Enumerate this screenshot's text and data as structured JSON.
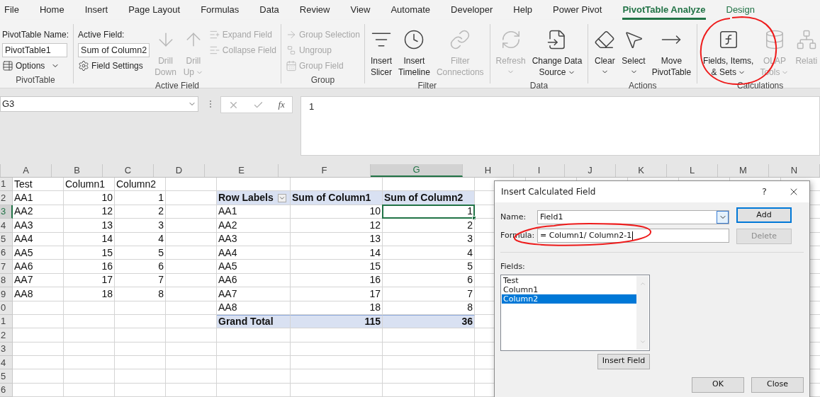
{
  "ribbon": {
    "tabs": [
      {
        "label": "File",
        "selected": false,
        "contextual": false
      },
      {
        "label": "Home",
        "selected": false,
        "contextual": false
      },
      {
        "label": "Insert",
        "selected": false,
        "contextual": false
      },
      {
        "label": "Page Layout",
        "selected": false,
        "contextual": false
      },
      {
        "label": "Formulas",
        "selected": false,
        "contextual": false
      },
      {
        "label": "Data",
        "selected": false,
        "contextual": false
      },
      {
        "label": "Review",
        "selected": false,
        "contextual": false
      },
      {
        "label": "View",
        "selected": false,
        "contextual": false
      },
      {
        "label": "Automate",
        "selected": false,
        "contextual": false
      },
      {
        "label": "Developer",
        "selected": false,
        "contextual": false
      },
      {
        "label": "Help",
        "selected": false,
        "contextual": false
      },
      {
        "label": "Power Pivot",
        "selected": false,
        "contextual": false
      },
      {
        "label": "PivotTable Analyze",
        "selected": true,
        "contextual": true
      },
      {
        "label": "Design",
        "selected": false,
        "contextual": true
      }
    ],
    "groups": [
      {
        "label": "PivotTable",
        "columns": [
          [
            {
              "kind": "label",
              "label": "PivotTable Name:"
            },
            {
              "kind": "field",
              "value": "PivotTable1"
            },
            {
              "kind": "small",
              "label": "Options",
              "disabled": false,
              "dropdown": true
            }
          ]
        ]
      },
      {
        "label": "Active Field",
        "columns": [
          [
            {
              "kind": "label",
              "label": "Active Field:"
            },
            {
              "kind": "field",
              "value": "Sum of Column2"
            },
            {
              "kind": "small",
              "label": "Field Settings",
              "disabled": false,
              "dropdown": false
            }
          ],
          [
            {
              "kind": "large",
              "label": "Drill\nDown",
              "disabled": true,
              "dropdown": false
            }
          ],
          [
            {
              "kind": "large",
              "label": "Drill\nUp",
              "disabled": true,
              "dropdown": true
            }
          ],
          [
            {
              "kind": "small",
              "label": "Expand Field",
              "disabled": true,
              "dropdown": false
            },
            {
              "kind": "small",
              "label": "Collapse Field",
              "disabled": true,
              "dropdown": false
            }
          ]
        ]
      },
      {
        "label": "Group",
        "columns": [
          [
            {
              "kind": "small",
              "label": "Group Selection",
              "disabled": true,
              "dropdown": false
            },
            {
              "kind": "small",
              "label": "Ungroup",
              "disabled": true,
              "dropdown": false
            },
            {
              "kind": "small",
              "label": "Group Field",
              "disabled": true,
              "dropdown": false
            }
          ]
        ]
      },
      {
        "label": "Filter",
        "columns": [
          [
            {
              "kind": "large",
              "label": "Insert\nSlicer",
              "disabled": false,
              "dropdown": false
            }
          ],
          [
            {
              "kind": "large",
              "label": "Insert\nTimeline",
              "disabled": false,
              "dropdown": false
            }
          ],
          [
            {
              "kind": "large",
              "label": "Filter\nConnections",
              "disabled": true,
              "dropdown": false
            }
          ]
        ]
      },
      {
        "label": "Data",
        "columns": [
          [
            {
              "kind": "large",
              "label": "Refresh",
              "disabled": true,
              "dropdown": true
            }
          ],
          [
            {
              "kind": "large",
              "label": "Change Data\nSource",
              "disabled": false,
              "dropdown": true
            }
          ]
        ]
      },
      {
        "label": "Actions",
        "columns": [
          [
            {
              "kind": "large",
              "label": "Clear",
              "disabled": false,
              "dropdown": true
            }
          ],
          [
            {
              "kind": "large",
              "label": "Select",
              "disabled": false,
              "dropdown": true
            }
          ],
          [
            {
              "kind": "large",
              "label": "Move\nPivotTable",
              "disabled": false,
              "dropdown": false
            }
          ]
        ]
      },
      {
        "label": "Calculations",
        "columns": [
          [
            {
              "kind": "large",
              "label": "Fields, Items,\n& Sets",
              "disabled": false,
              "dropdown": true
            }
          ],
          [
            {
              "kind": "large",
              "label": "OLAP\nTools",
              "disabled": true,
              "dropdown": true
            }
          ],
          [
            {
              "kind": "large",
              "label": "Relati",
              "disabled": true,
              "dropdown": false
            }
          ]
        ]
      }
    ]
  },
  "formula_bar": {
    "name_box": "G3",
    "function_button": "fx",
    "formula": "1"
  },
  "sheet": {
    "columns": [
      {
        "label": "A",
        "selected": false
      },
      {
        "label": "B",
        "selected": false
      },
      {
        "label": "C",
        "selected": false
      },
      {
        "label": "D",
        "selected": false
      },
      {
        "label": "E",
        "selected": false
      },
      {
        "label": "F",
        "selected": false
      },
      {
        "label": "G",
        "selected": true
      },
      {
        "label": "H",
        "selected": false
      },
      {
        "label": "I",
        "selected": false
      },
      {
        "label": "J",
        "selected": false
      },
      {
        "label": "K",
        "selected": false
      },
      {
        "label": "L",
        "selected": false
      },
      {
        "label": "M",
        "selected": false
      },
      {
        "label": "N",
        "selected": false
      }
    ],
    "rows": [
      {
        "label": "1",
        "selected": false,
        "kind": "data",
        "cells": {
          "A": "Test",
          "B": "Column1",
          "C": "Column2"
        }
      },
      {
        "label": "2",
        "selected": false,
        "kind": "pivot_header",
        "cells": {
          "A": "AA1",
          "B": "10",
          "C": "1",
          "E": "Row Labels",
          "F": "Sum of Column1",
          "G": "Sum of Column2"
        }
      },
      {
        "label": "3",
        "selected": true,
        "kind": "data",
        "cells": {
          "A": "AA2",
          "B": "12",
          "C": "2",
          "E": "AA1",
          "F": "10",
          "G": "1"
        }
      },
      {
        "label": "4",
        "selected": false,
        "kind": "data",
        "cells": {
          "A": "AA3",
          "B": "13",
          "C": "3",
          "E": "AA2",
          "F": "12",
          "G": "2"
        }
      },
      {
        "label": "5",
        "selected": false,
        "kind": "data",
        "cells": {
          "A": "AA4",
          "B": "14",
          "C": "4",
          "E": "AA3",
          "F": "13",
          "G": "3"
        }
      },
      {
        "label": "6",
        "selected": false,
        "kind": "data",
        "cells": {
          "A": "AA5",
          "B": "15",
          "C": "5",
          "E": "AA4",
          "F": "14",
          "G": "4"
        }
      },
      {
        "label": "7",
        "selected": false,
        "kind": "data",
        "cells": {
          "A": "AA6",
          "B": "16",
          "C": "6",
          "E": "AA5",
          "F": "15",
          "G": "5"
        }
      },
      {
        "label": "8",
        "selected": false,
        "kind": "data",
        "cells": {
          "A": "AA7",
          "B": "17",
          "C": "7",
          "E": "AA6",
          "F": "16",
          "G": "6"
        }
      },
      {
        "label": "9",
        "selected": false,
        "kind": "data",
        "cells": {
          "A": "AA8",
          "B": "18",
          "C": "8",
          "E": "AA7",
          "F": "17",
          "G": "7"
        }
      },
      {
        "label": "0",
        "selected": false,
        "kind": "data",
        "cells": {
          "E": "AA8",
          "F": "18",
          "G": "8"
        }
      },
      {
        "label": "1",
        "selected": false,
        "kind": "pivot_total",
        "cells": {
          "E": "Grand Total",
          "F": "115",
          "G": "36"
        }
      },
      {
        "label": "2",
        "selected": false,
        "kind": "data",
        "cells": {}
      },
      {
        "label": "3",
        "selected": false,
        "kind": "data",
        "cells": {}
      },
      {
        "label": "4",
        "selected": false,
        "kind": "data",
        "cells": {}
      },
      {
        "label": "5",
        "selected": false,
        "kind": "data",
        "cells": {}
      },
      {
        "label": "6",
        "selected": false,
        "kind": "data",
        "cells": {}
      }
    ]
  },
  "dialog": {
    "title": "Insert Calculated Field",
    "help": "?",
    "name_label": "Name:",
    "name_value": "Field1",
    "formula_label": "Formula:",
    "formula_value": "= Column1/ Column2-1",
    "buttons": [
      {
        "label": "Add",
        "default": true,
        "disabled": false
      },
      {
        "label": "Delete",
        "default": false,
        "disabled": true
      }
    ],
    "fields_label": "Fields:",
    "fields": [
      {
        "label": "Test",
        "selected": false
      },
      {
        "label": "Column1",
        "selected": false
      },
      {
        "label": "Column2",
        "selected": true
      }
    ],
    "insert_button": "Insert Field",
    "ok_button": "OK",
    "close_button": "Close"
  }
}
